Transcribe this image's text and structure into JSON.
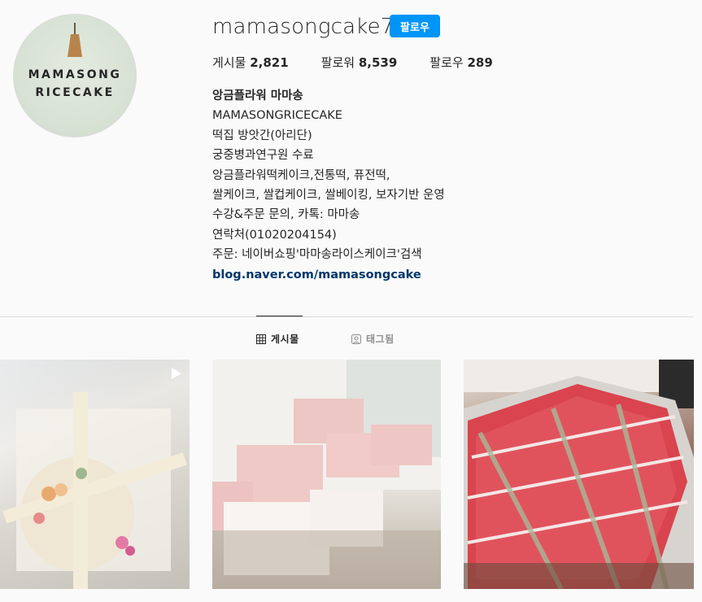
{
  "profile": {
    "avatar_logo_line1": "MAMASONG",
    "avatar_logo_line2": "RICECAKE",
    "username": "mamasongcake7",
    "follow_label": "팔로우",
    "stats": {
      "posts_label": "게시물",
      "posts_value": "2,821",
      "followers_label": "팔로워",
      "followers_value": "8,539",
      "following_label": "팔로우",
      "following_value": "289"
    },
    "bio": {
      "name": "앙금플라워 마마송",
      "lines": [
        "MAMASONGRICECAKE",
        "떡집 방앗간(아리단)",
        "궁중병과연구원 수료",
        "앙금플라워떡케이크,전통떡, 퓨전떡,",
        "쌀케이크, 쌀컵케이크, 쌀베이킹, 보자기반 운영",
        "수강&주문 문의, 카톡: 마마송",
        "연락처(01020204154)",
        "주문: 네이버쇼핑'마마송라이스케이크'검색"
      ],
      "link": "blog.naver.com/mamasongcake"
    }
  },
  "tabs": {
    "posts_label": "게시물",
    "tagged_label": "태그됨"
  },
  "colors": {
    "accent": "#0095f6",
    "link": "#00376b",
    "background": "#fafafa"
  },
  "icons": {
    "posts_tab": "grid-icon",
    "tagged_tab": "tag-user-icon",
    "video": "video-play-icon"
  }
}
